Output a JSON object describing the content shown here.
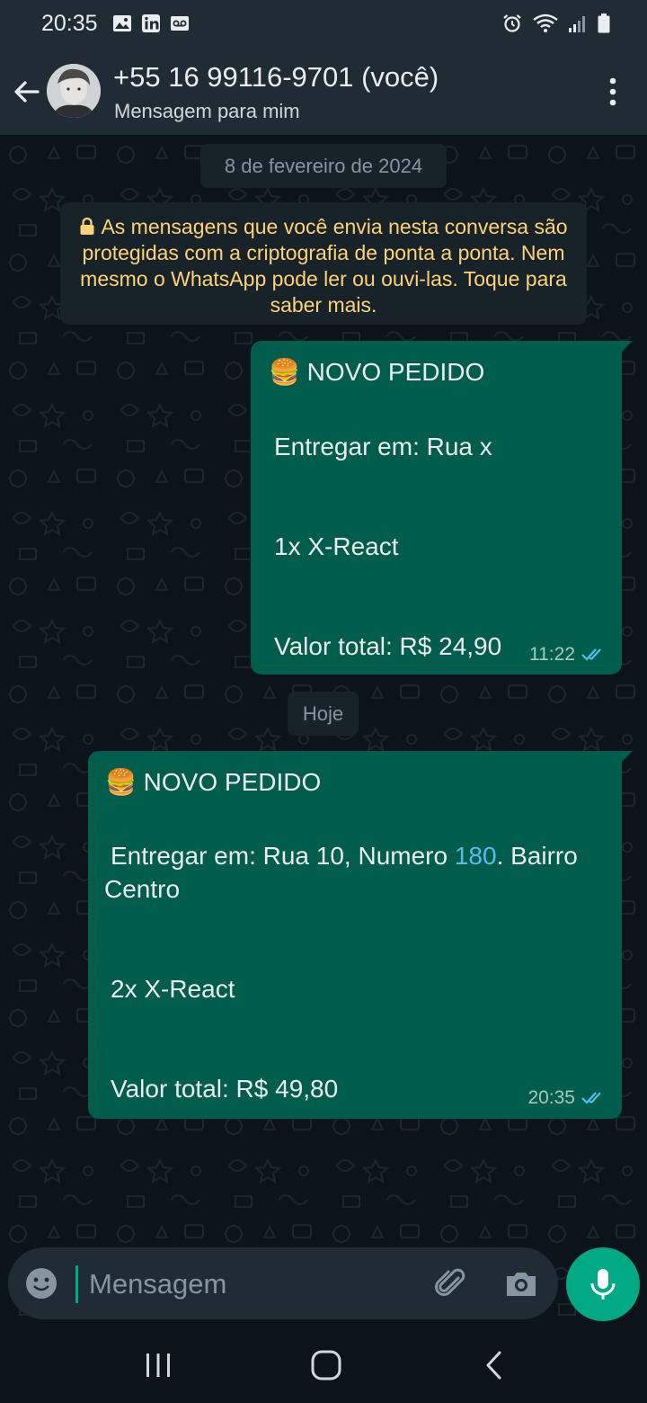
{
  "status": {
    "time": "20:35"
  },
  "header": {
    "contact_name": "+55 16 99116-9701 (você)",
    "subtitle": "Mensagem para mim"
  },
  "chat": {
    "date_chip_1": "8 de fevereiro de 2024",
    "encryption_notice": "As mensagens que você envia nesta conversa são protegidas com a criptografia de ponta a ponta. Nem mesmo o WhatsApp pode ler ou ouvi-las. Toque para saber mais.",
    "date_chip_2": "Hoje",
    "messages": [
      {
        "emoji": "🍔",
        "title": "NOVO PEDIDO",
        "address": "Entregar em: Rua x",
        "item": "1x X-React",
        "total": "Valor total: R$ 24,90",
        "time": "11:22"
      },
      {
        "emoji": "🍔",
        "title": "NOVO PEDIDO",
        "address_before_link": "Entregar em: Rua 10, Numero ",
        "address_link": "180",
        "address_after_link": ". Bairro",
        "address_line2": "Centro",
        "item": "2x X-React",
        "total": "Valor total: R$ 49,80",
        "time": "20:35"
      }
    ]
  },
  "input": {
    "placeholder": "Mensagem"
  },
  "colors": {
    "background": "#0b141a",
    "header": "#1f2c34",
    "outgoing_bubble": "#005c4b",
    "accent": "#00a884",
    "notice_text": "#ffd279",
    "read_ticks": "#53bdeb"
  }
}
